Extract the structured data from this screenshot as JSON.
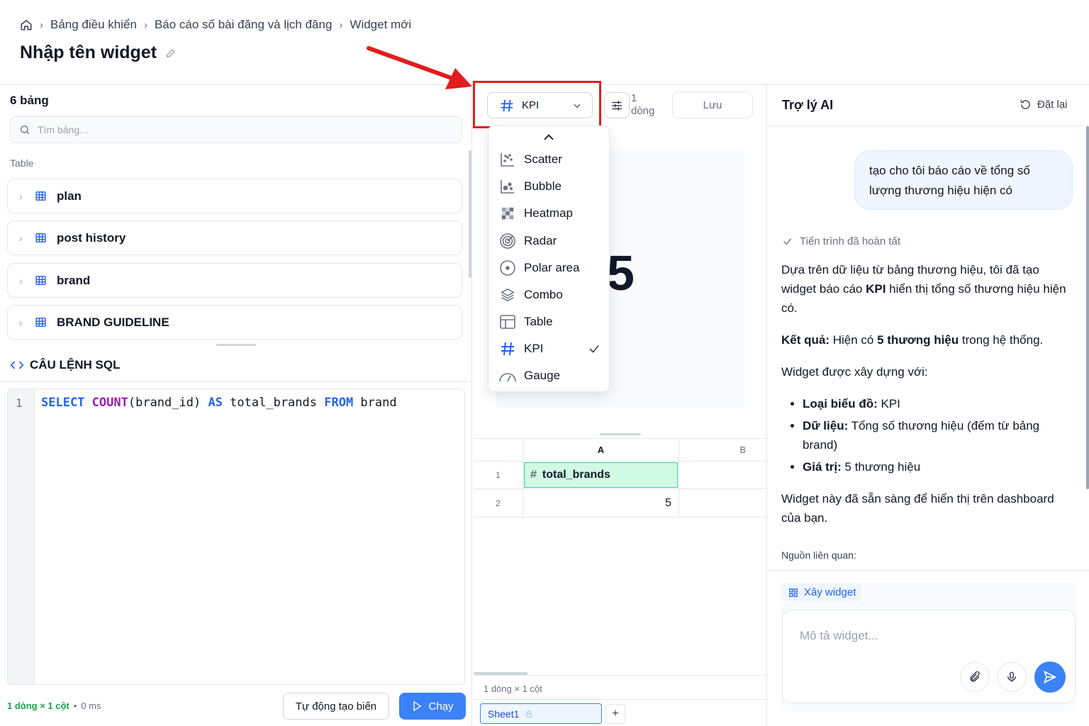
{
  "breadcrumb": [
    "Bảng điều khiển",
    "Báo cáo số bài đăng và lịch đăng",
    "Widget mới"
  ],
  "page_title": "Nhập tên widget",
  "left": {
    "tables_count": "6 bảng",
    "search_placeholder": "Tìm bảng...",
    "section_label": "Table",
    "tables": [
      "plan",
      "post history",
      "brand",
      "BRAND GUIDELINE"
    ],
    "sql_title": "CÂU LỆNH SQL",
    "line_number": "1",
    "sql": {
      "k1": "SELECT",
      "f1": "COUNT",
      "t1": "(brand_id) ",
      "k2": "AS",
      "t2": " total_brands ",
      "k3": "FROM",
      "t3": " brand"
    },
    "status_dims": "1 dòng × 1 cột",
    "status_dot": "•",
    "status_time": "0 ms",
    "auto_button": "Tự động tạo biến",
    "run_button": "Chạy"
  },
  "middle": {
    "chart_type": "KPI",
    "rows_info_num": "1",
    "rows_info_word": "dòng",
    "save_button": "Lưu",
    "kpi_value": "5",
    "dropdown": [
      "Scatter",
      "Bubble",
      "Heatmap",
      "Radar",
      "Polar area",
      "Combo",
      "Table",
      "KPI",
      "Gauge"
    ],
    "selected": "KPI",
    "grid": {
      "col_a": "A",
      "col_b": "B",
      "row1": "1",
      "row2": "2",
      "hash": "#",
      "header": "total_brands",
      "value": "5"
    },
    "grid_dims": "1 dòng × 1 cột",
    "sheet": "Sheet1",
    "add_sheet": "+"
  },
  "right": {
    "title": "Trợ lý AI",
    "reset": "Đặt lại",
    "user_msg": "tạo cho tôi báo cáo về tổng số lượng thương hiệu hiện có",
    "done": "Tiến trình đã hoàn tất",
    "p1a": "Dựa trên dữ liệu từ bảng thương hiệu, tôi đã tạo widget báo cáo ",
    "p1b": "KPI",
    "p1c": " hiển thị tổng số thương hiệu hiện có.",
    "p2a": "Kết quả:",
    "p2b": " Hiện có ",
    "p2c": "5 thương hiệu",
    "p2d": " trong hệ thống.",
    "p3": "Widget được xây dựng với:",
    "b1a": "Loại biểu đồ:",
    "b1b": " KPI",
    "b2a": "Dữ liệu:",
    "b2b": " Tổng số thương hiệu (đếm từ bảng brand)",
    "b3a": "Giá trị:",
    "b3b": " 5 thương hiệu",
    "p4": "Widget này đã sẵn sàng để hiển thị trên dashboard của bạn.",
    "sources": "Nguồn liên quan:",
    "build_tag": "Xây widget",
    "input_placeholder": "Mô tả widget..."
  },
  "colors": {
    "accent": "#3b82f6",
    "highlight": "#e11d1d",
    "cell_bg": "#d1fae5"
  }
}
